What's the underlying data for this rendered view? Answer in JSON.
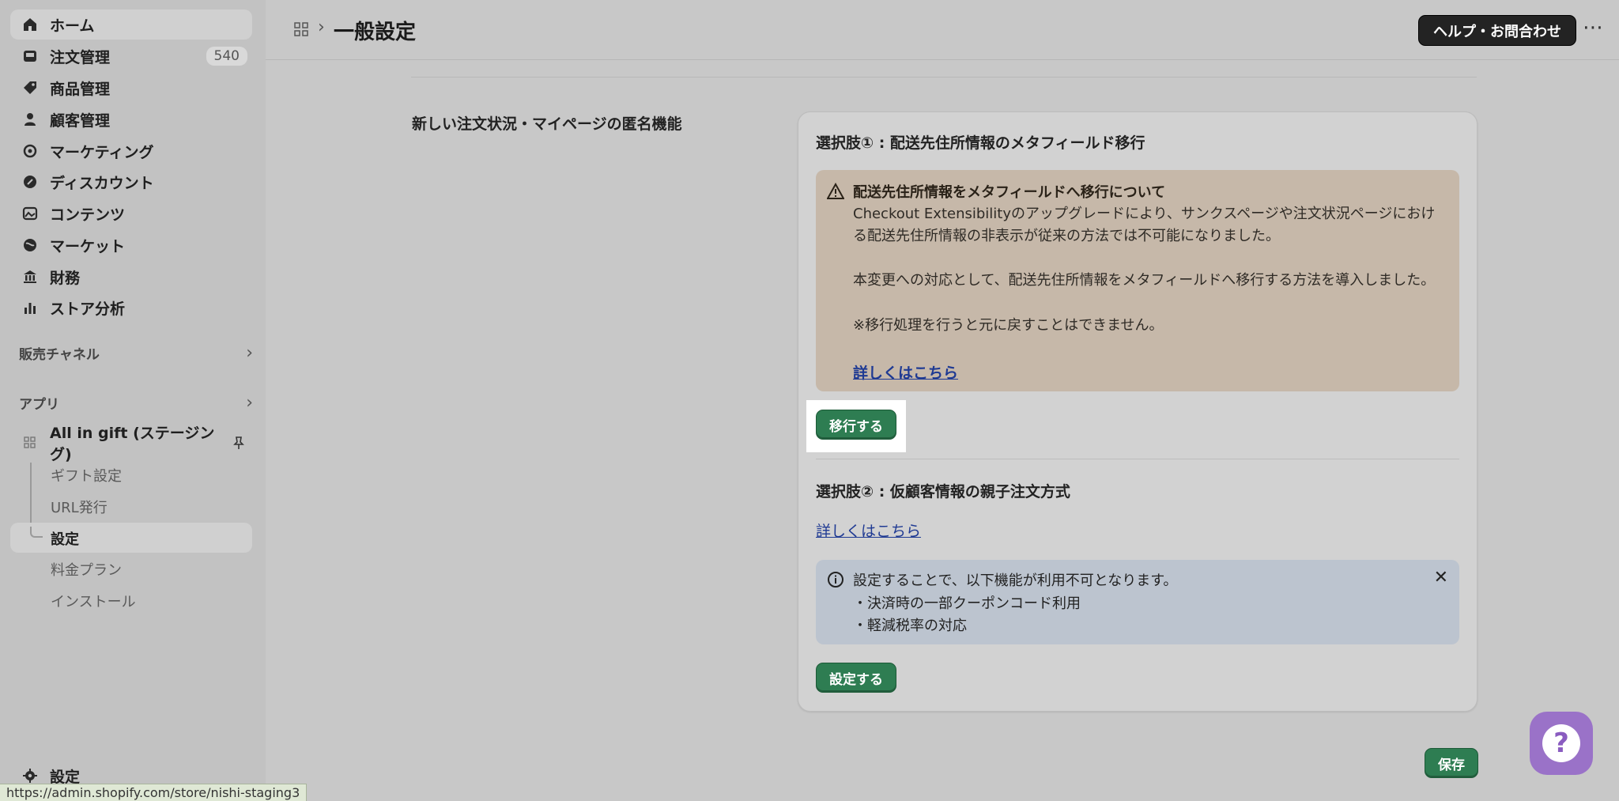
{
  "sidebar": {
    "items": [
      {
        "label": "ホーム",
        "icon": "home-icon"
      },
      {
        "label": "注文管理",
        "icon": "inbox-icon",
        "badge": "540"
      },
      {
        "label": "商品管理",
        "icon": "tag-icon"
      },
      {
        "label": "顧客管理",
        "icon": "person-icon"
      },
      {
        "label": "マーケティング",
        "icon": "target-icon"
      },
      {
        "label": "ディスカウント",
        "icon": "discount-icon"
      },
      {
        "label": "コンテンツ",
        "icon": "image-icon"
      },
      {
        "label": "マーケット",
        "icon": "globe-icon"
      },
      {
        "label": "財務",
        "icon": "bank-icon"
      },
      {
        "label": "ストア分析",
        "icon": "bar-chart-icon"
      }
    ],
    "sales_channels": "販売チャネル",
    "apps": "アプリ",
    "app_name": "All in gift (ステージング)",
    "app_sub": [
      "ギフト設定",
      "URL発行",
      "設定",
      "料金プラン",
      "インストール"
    ],
    "settings": "設定"
  },
  "header": {
    "title": "一般設定",
    "help_label": "ヘルプ・お問合わせ",
    "more": "⋯"
  },
  "main": {
    "section_label": "新しい注文状況・マイページの匿名機能",
    "option1_title": "選択肢① : 配送先住所情報のメタフィールド移行",
    "warning": {
      "title": "配送先住所情報をメタフィールドへ移行について",
      "line1": "Checkout Extensibilityのアップグレードにより、サンクスページや注文状況ページにおけ",
      "line2": "る配送先住所情報の非表示が従来の方法では不可能になりました。",
      "line3": "本変更への対応として、配送先住所情報をメタフィールドへ移行する方法を導入しました。",
      "line4": "※移行処理を行うと元に戻すことはできません。",
      "link": "詳しくはこちら"
    },
    "migrate_button": "移行する",
    "option2_title": "選択肢② : 仮顧客情報の親子注文方式",
    "option2_link": "詳しくはこちら",
    "info": {
      "line1": "設定することで、以下機能が利用不可となります。",
      "line2": "・決済時の一部クーポンコード利用",
      "line3": "・軽減税率の対応",
      "close": "✕"
    },
    "set_button": "設定する",
    "save_button": "保存"
  },
  "help_bubble": "?",
  "status_url": "https://admin.shopify.com/store/nishi-staging3",
  "colors": {
    "primary_green": "#2e7d52",
    "warning_bg": "#c6b8a9",
    "info_bg": "#bcc4cf",
    "help_bubble": "#9a72c8"
  }
}
